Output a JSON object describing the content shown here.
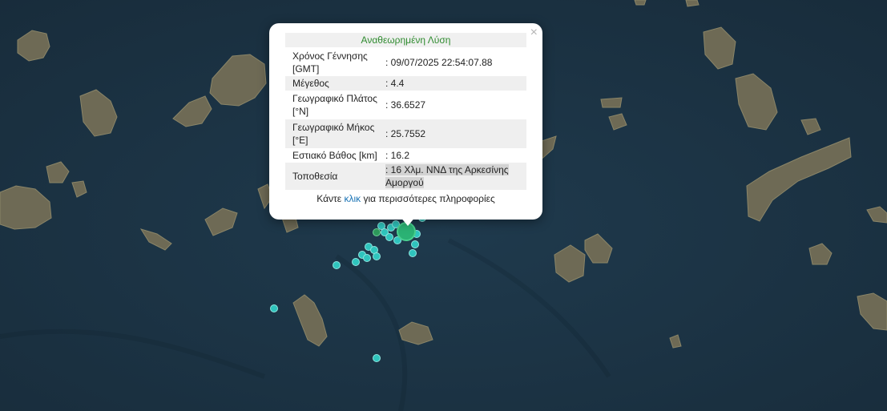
{
  "popup": {
    "title": "Αναθεωρημένη Λύση",
    "close_label": "×",
    "rows": [
      {
        "label": "Χρόνος Γέννησης [GMT]",
        "value": ": 09/07/2025 22:54:07.88"
      },
      {
        "label": "Μέγεθος",
        "value": ": 4.4"
      },
      {
        "label": "Γεωγραφικό Πλάτος [°N]",
        "value": ": 36.6527"
      },
      {
        "label": "Γεωγραφικό Μήκος [°E]",
        "value": ": 25.7552"
      },
      {
        "label": "Εστιακό Βάθος [km]",
        "value": ": 16.2"
      },
      {
        "label": "Τοποθεσία",
        "value": ": 16 Χλμ. ΝΝΔ της Αρκεσίνης Αμοργού"
      }
    ],
    "footer": {
      "before": "Κάντε ",
      "link": "κλικ",
      "after": " για περισσότερες πληροφορίες"
    }
  },
  "colors": {
    "sea": "#1d3446",
    "land": "#6e6a55",
    "marker_main": "#2bb274",
    "marker_small": "#2fc4bd",
    "title_text": "#2f8b2f",
    "link": "#1a73b5"
  }
}
